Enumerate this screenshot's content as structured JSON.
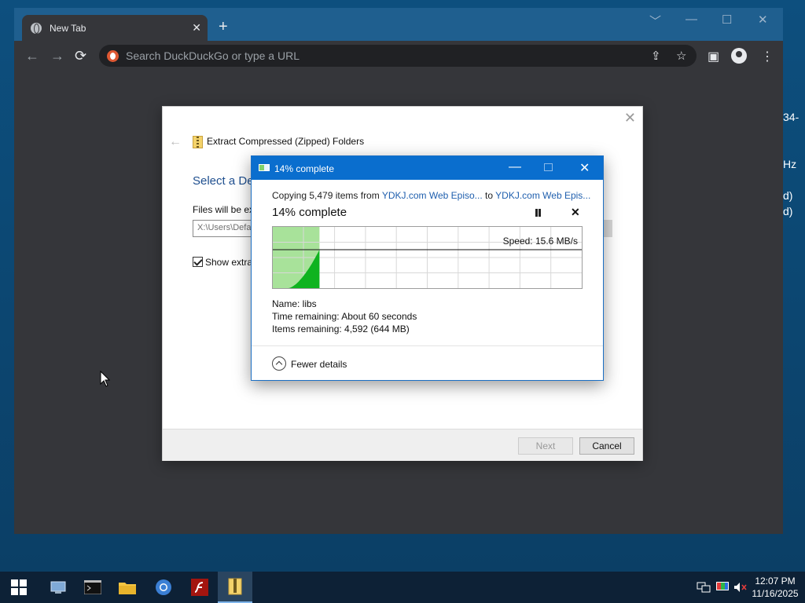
{
  "desktop": {
    "fragments": [
      "34-",
      "Hz",
      "d)",
      "d)"
    ]
  },
  "browser": {
    "tab_title": "New Tab",
    "tab_close": "✕",
    "new_tab": "+",
    "win_controls": [
      "﹀",
      "—",
      "☐",
      "✕"
    ],
    "nav": {
      "back": "←",
      "forward": "→",
      "reload": "⟳"
    },
    "omnibox_placeholder": "Search DuckDuckGo or type a URL",
    "share_icon": "⇪",
    "bookmark_icon": "☆",
    "sidepanel_icon": "▣",
    "menu_icon": "⋮"
  },
  "wizard": {
    "close": "✕",
    "back": "←",
    "title": "Extract Compressed (Zipped) Folders",
    "heading": "Select a De",
    "files_label": "Files will be ex",
    "path_value": "X:\\Users\\Defa",
    "show_label": "Show extrac",
    "next_label": "Next",
    "cancel_label": "Cancel"
  },
  "progress": {
    "title": "14% complete",
    "min": "—",
    "close": "✕",
    "copying_prefix": "Copying 5,479 items from ",
    "source_link": "YDKJ.com Web Episo...",
    "to_text": " to ",
    "dest_link": "YDKJ.com Web Epis...",
    "percent_text": "14% complete",
    "percent_value": 0.14,
    "cancel_glyph": "✕",
    "speed_text": "Speed: 15.6 MB/s",
    "name_text": "Name:  libs",
    "time_text": "Time remaining:  About 60 seconds",
    "items_text": "Items remaining:  4,592 (644 MB)",
    "fewer_details": "Fewer details"
  },
  "taskbar": {
    "clock_time": "12:07 PM",
    "clock_date": "11/16/2025"
  },
  "colors": {
    "titlebar": "#0a6ece",
    "progress_fill": "#a8e29a",
    "graph_fill": "#0fb31f",
    "link": "#1f5fae"
  }
}
